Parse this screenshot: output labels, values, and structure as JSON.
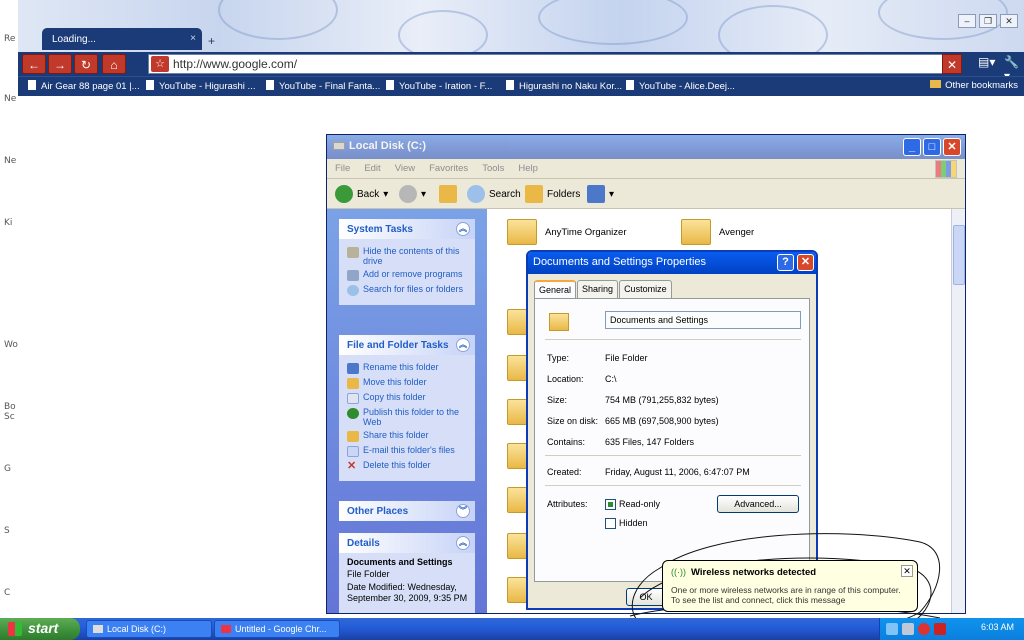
{
  "browser": {
    "tab_title": "Loading...",
    "tab_close": "×",
    "new_tab": "+",
    "url": "http://www.google.com/",
    "bookmarks": [
      "Air Gear 88 page 01 |...",
      "YouTube - Higurashi ...",
      "YouTube - Final Fanta...",
      "YouTube - Iration - F...",
      "Higurashi no Naku Kor...",
      "YouTube - Alice.Deej..."
    ],
    "other_bookmarks": "Other bookmarks"
  },
  "desktop": {
    "labels": [
      "Re",
      "Ne",
      "Ne",
      "Ki",
      "Wo",
      "Bo",
      "Sc",
      "G",
      "S",
      "C"
    ]
  },
  "explorer": {
    "title": "Local Disk (C:)",
    "menu": [
      "File",
      "Edit",
      "View",
      "Favorites",
      "Tools",
      "Help"
    ],
    "toolbar": {
      "back": "Back",
      "search": "Search",
      "folders": "Folders"
    },
    "system_tasks": {
      "title": "System Tasks",
      "items": [
        "Hide the contents of this drive",
        "Add or remove programs",
        "Search for files or folders"
      ]
    },
    "file_folder_tasks": {
      "title": "File and Folder Tasks",
      "items": [
        "Rename this folder",
        "Move this folder",
        "Copy this folder",
        "Publish this folder to the Web",
        "Share this folder",
        "E-mail this folder's files",
        "Delete this folder"
      ]
    },
    "other_places": {
      "title": "Other Places"
    },
    "details": {
      "title": "Details",
      "name": "Documents and Settings",
      "type": "File Folder",
      "modified": "Date Modified: Wednesday, September 30, 2009, 9:35 PM"
    },
    "folders": [
      "AnyTime Organizer",
      "Avenger"
    ]
  },
  "properties": {
    "title": "Documents and Settings Properties",
    "tabs": [
      "General",
      "Sharing",
      "Customize"
    ],
    "name": "Documents and Settings",
    "fields": {
      "type_label": "Type:",
      "type": "File Folder",
      "location_label": "Location:",
      "location": "C:\\",
      "size_label": "Size:",
      "size": "754 MB (791,255,832 bytes)",
      "size_on_disk_label": "Size on disk:",
      "size_on_disk": "665 MB (697,508,900 bytes)",
      "contains_label": "Contains:",
      "contains": "635 Files, 147 Folders",
      "created_label": "Created:",
      "created": "Friday, August 11, 2006, 6:47:07 PM",
      "attributes_label": "Attributes:"
    },
    "readonly": "Read-only",
    "hidden": "Hidden",
    "advanced": "Advanced...",
    "ok": "OK"
  },
  "balloon": {
    "title": "Wireless networks detected",
    "message": "One or more wireless networks are in range of this computer. To see the list and connect, click this message"
  },
  "taskbar": {
    "start": "start",
    "tasks": [
      "Local Disk (C:)",
      "Untitled - Google Chr..."
    ],
    "clock": "6:03 AM"
  }
}
